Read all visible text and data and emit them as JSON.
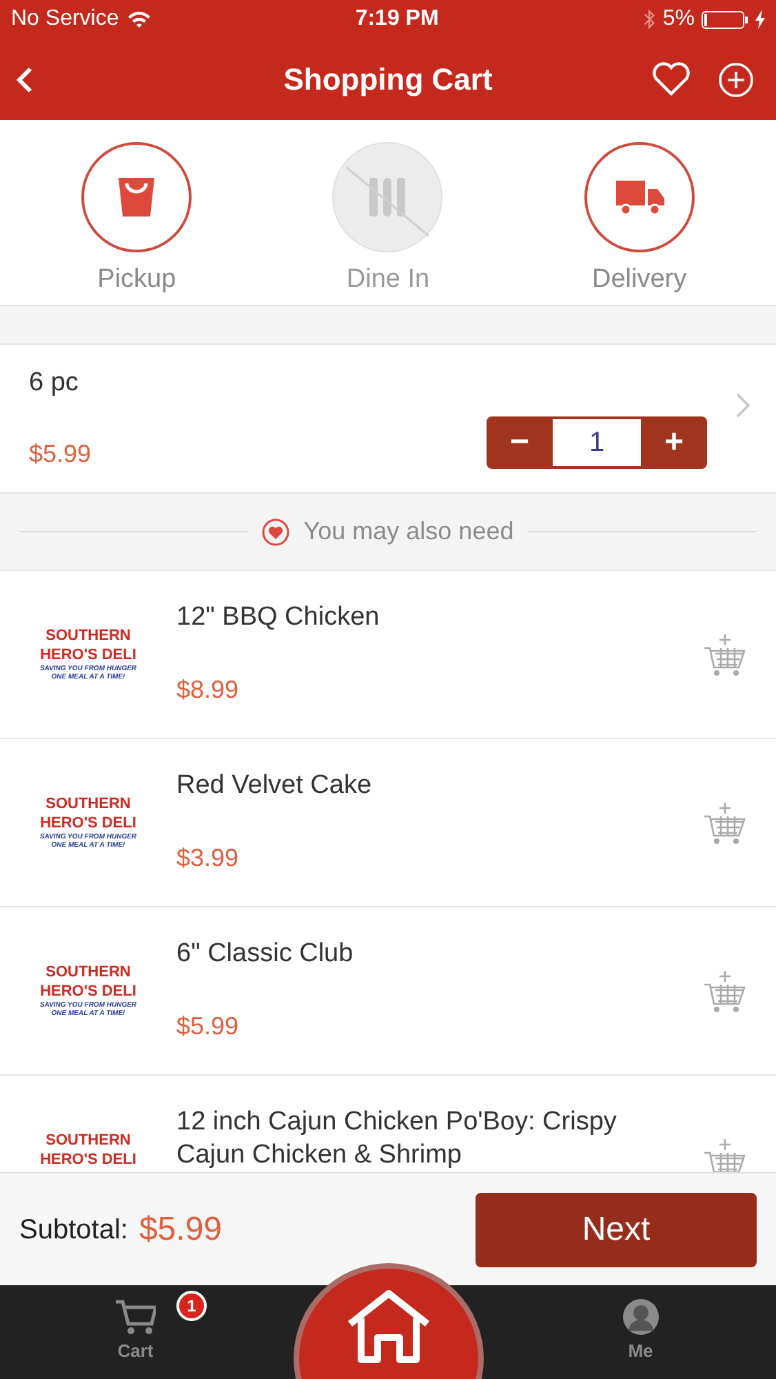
{
  "status_bar": {
    "carrier": "No Service",
    "time": "7:19 PM",
    "battery": "5%"
  },
  "header": {
    "title": "Shopping Cart"
  },
  "order_types": [
    {
      "kind": "pickup",
      "label": "Pickup",
      "disabled": false
    },
    {
      "kind": "dinein",
      "label": "Dine In",
      "disabled": true
    },
    {
      "kind": "delivery",
      "label": "Delivery",
      "disabled": false
    }
  ],
  "cart_item": {
    "name": "6 pc",
    "price": "$5.99",
    "quantity": "1",
    "minus": "−",
    "plus": "+"
  },
  "suggestions_heading": "You may also need",
  "suggestions": [
    {
      "name": "12\" BBQ Chicken",
      "price": "$8.99",
      "logo": {
        "lines": [
          "SOUTHERN",
          "HERO'S DELI"
        ],
        "tagline": [
          "SAVING YOU FROM HUNGER",
          "ONE MEAL AT A TIME!"
        ]
      }
    },
    {
      "name": "Red Velvet Cake",
      "price": "$3.99",
      "logo": {
        "lines": [
          "SOUTHERN",
          "HERO'S DELI"
        ],
        "tagline": [
          "SAVING YOU FROM HUNGER",
          "ONE MEAL AT A TIME!"
        ]
      }
    },
    {
      "name": "6\" Classic Club",
      "price": "$5.99",
      "logo": {
        "lines": [
          "SOUTHERN",
          "HERO'S DELI"
        ],
        "tagline": [
          "SAVING YOU FROM HUNGER",
          "ONE MEAL AT A TIME!"
        ]
      }
    },
    {
      "name": "12 inch Cajun Chicken Po'Boy: Crispy Cajun Chicken & Shrimp",
      "logo": {
        "lines": [
          "SOUTHERN",
          "HERO'S DELI"
        ]
      }
    }
  ],
  "footer": {
    "subtotal_label": "Subtotal:",
    "subtotal": "$5.99",
    "next": "Next"
  },
  "tab_bar": [
    {
      "kind": "cart",
      "label": "Cart",
      "badge": "1"
    },
    {
      "kind": "home"
    },
    {
      "kind": "me",
      "label": "Me"
    }
  ]
}
